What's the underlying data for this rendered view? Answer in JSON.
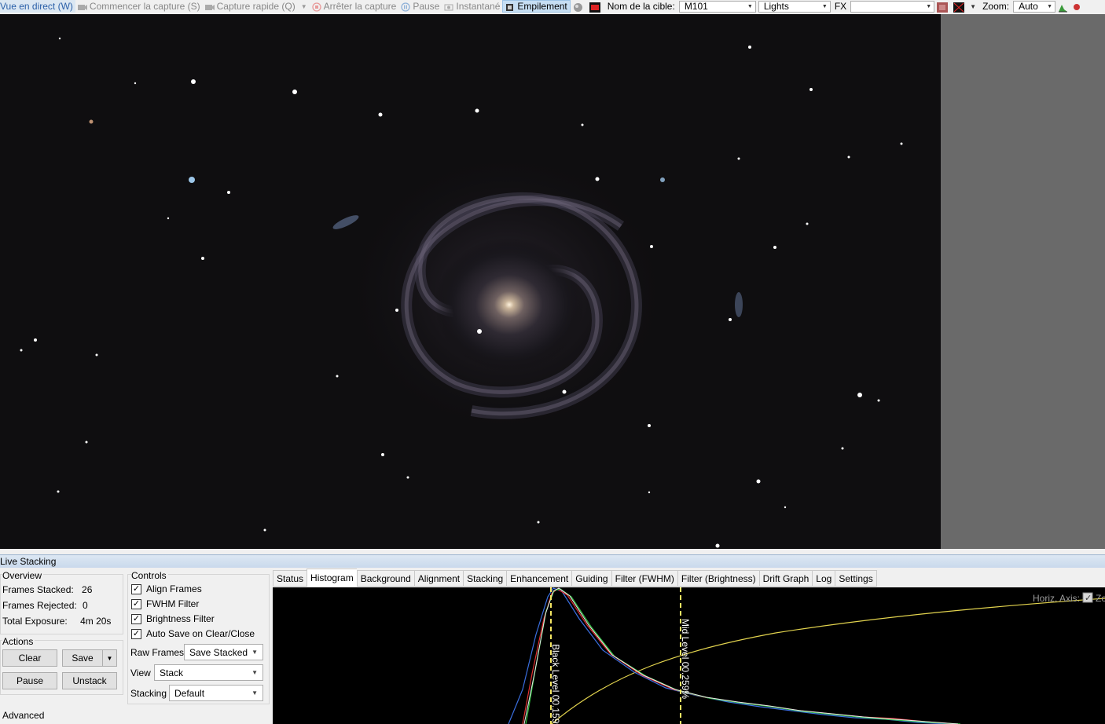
{
  "toolbar": {
    "live_view": "Vue en direct (W)",
    "start_capture": "Commencer la capture (S)",
    "quick_capture": "Capture rapide (Q)",
    "stop_capture": "Arrêter la capture",
    "pause": "Pause",
    "snapshot": "Instantané",
    "stacking": "Empilement",
    "target_label": "Nom de la cible:",
    "target_value": "M101",
    "frame_type": "Lights",
    "fx_label": "FX",
    "fx_value": "",
    "zoom_label": "Zoom:",
    "zoom_value": "Auto"
  },
  "live_stacking": {
    "title": "Live Stacking",
    "overview": {
      "heading": "Overview",
      "frames_stacked_label": "Frames Stacked:",
      "frames_stacked": "26",
      "frames_rejected_label": "Frames Rejected:",
      "frames_rejected": "0",
      "total_exposure_label": "Total Exposure:",
      "total_exposure": "4m 20s"
    },
    "actions": {
      "heading": "Actions",
      "clear": "Clear",
      "save": "Save",
      "pause": "Pause",
      "unstack": "Unstack"
    },
    "advanced": "Advanced",
    "controls": {
      "heading": "Controls",
      "align_frames": "Align Frames",
      "fwhm_filter": "FWHM Filter",
      "brightness_filter": "Brightness Filter",
      "auto_save": "Auto Save on Clear/Close",
      "raw_frames_label": "Raw Frames",
      "raw_frames_value": "Save Stacked",
      "view_label": "View",
      "view_value": "Stack",
      "stacking_label": "Stacking",
      "stacking_value": "Default"
    },
    "tabs": [
      "Status",
      "Histogram",
      "Background",
      "Alignment",
      "Stacking",
      "Enhancement",
      "Guiding",
      "Filter (FWHM)",
      "Filter (Brightness)",
      "Drift Graph",
      "Log",
      "Settings"
    ],
    "selected_tab": "Histogram",
    "histogram": {
      "black_level": "Black Level 00.159%",
      "mid_level": "Mid Level 00.259%",
      "horiz_axis": "Horiz. Axis:",
      "horiz_axis_checkbox": "Zo"
    }
  },
  "colors": {
    "accent": "#c6def3",
    "level_line": "#f5e663",
    "curve": "#e2d34e"
  }
}
